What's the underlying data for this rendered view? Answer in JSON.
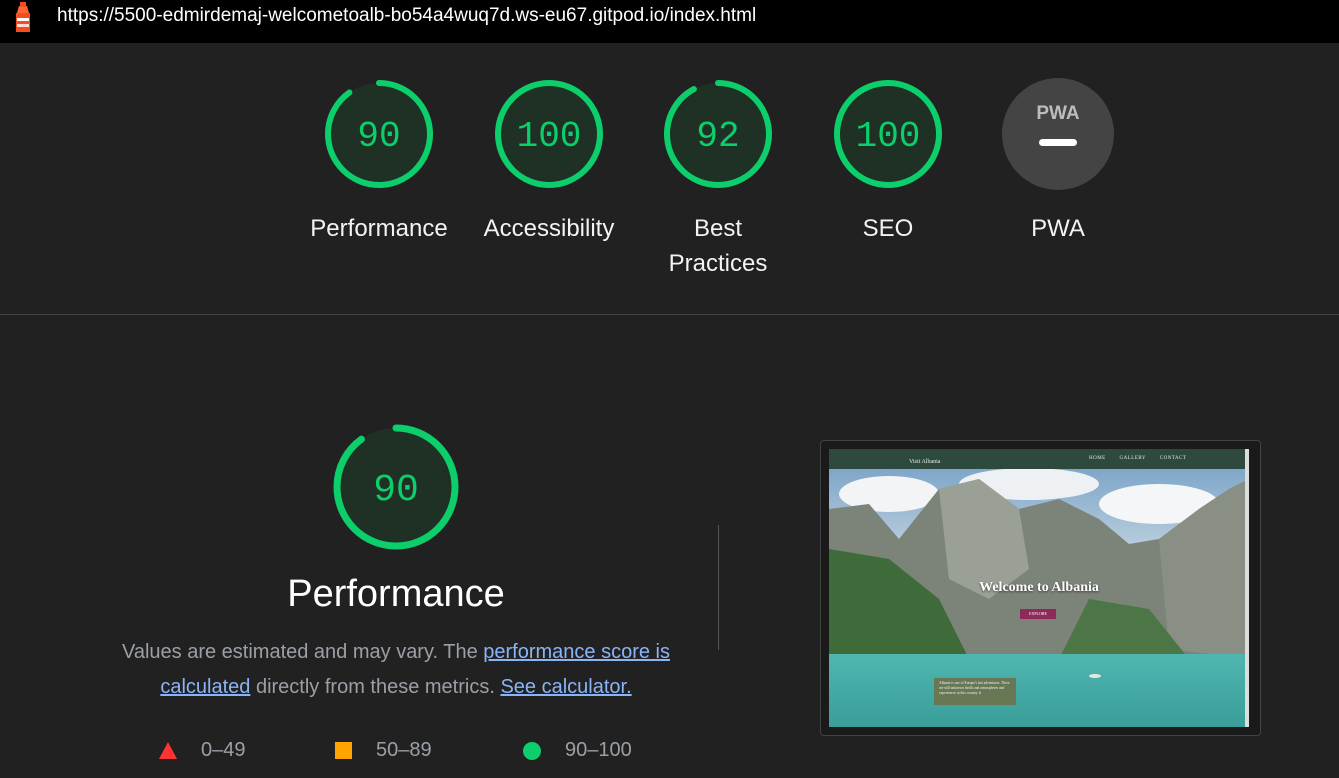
{
  "browser": {
    "url": "https://5500-edmirdemaj-welcometoalb-bo54a4wuq7d.ws-eu67.gitpod.io/index.html"
  },
  "scores": [
    {
      "label": "Performance",
      "value": 90,
      "display": "90"
    },
    {
      "label": "Accessibility",
      "value": 100,
      "display": "100"
    },
    {
      "label": "Best Practices",
      "value": 92,
      "display": "92"
    },
    {
      "label": "SEO",
      "value": 100,
      "display": "100"
    },
    {
      "label": "PWA",
      "value": null,
      "display": "PWA"
    }
  ],
  "performance": {
    "score": "90",
    "score_value": 90,
    "title": "Performance",
    "desc_part1": "Values are estimated and may vary. The ",
    "link1": "performance score is calculated",
    "desc_part2": " directly from these metrics. ",
    "link2": "See calculator."
  },
  "legend": [
    {
      "range": "0–49",
      "shape": "triangle",
      "color": "#ff3333"
    },
    {
      "range": "50–89",
      "shape": "square",
      "color": "#ffa400"
    },
    {
      "range": "90–100",
      "shape": "circle",
      "color": "#0cce6b"
    }
  ],
  "screenshot": {
    "brand": "Visit Albania",
    "nav_links": [
      "HOME",
      "GALLERY",
      "CONTACT"
    ],
    "hero_title": "Welcome to Albania",
    "button": "EXPLORE",
    "info_text": "Albania is one of Europe's last adventures. There are still unknown thrills and atmospheres and experiences in this country ⬇"
  },
  "colors": {
    "pass": "#0cce6b",
    "pass_bg": "#1f3024",
    "background": "#212121",
    "link": "#8ab4f8"
  }
}
